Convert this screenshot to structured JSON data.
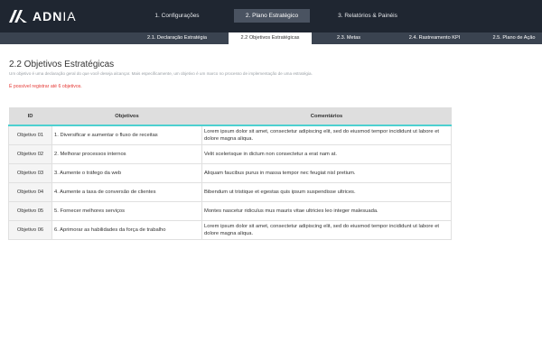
{
  "app": {
    "logo_text": "ADN",
    "logo_text_thin": "IA"
  },
  "main_tabs": [
    {
      "label": "1. Configurações",
      "active": false
    },
    {
      "label": "2. Plano Estratégico",
      "active": true
    },
    {
      "label": "3. Relatórios & Painéis",
      "active": false
    }
  ],
  "sub_tabs": [
    {
      "label": "2.1. Declaração Estratégia",
      "active": false
    },
    {
      "label": "2.2 Objetivos Estratégicas",
      "active": true
    },
    {
      "label": "2.3. Metas",
      "active": false
    },
    {
      "label": "2.4. Rastreamento KPI",
      "active": false
    },
    {
      "label": "2.5. Plano de Ação",
      "active": false
    }
  ],
  "page": {
    "title": "2.2 Objetivos Estratégicas",
    "description": "Um objetivo é uma declaração geral do que você deseja alcançar. Mais especificamente, um objetivo é um marco no processo de implementação de uma estratégia.",
    "limit_note": "É possível registrar até 6 objetivos."
  },
  "table": {
    "headers": {
      "id": "ID",
      "objective": "Objetivos",
      "comments": "Comentários"
    },
    "rows": [
      {
        "id": "Objetivo 01",
        "objective": "1. Diversificar e aumentar o fluxo de receitas",
        "comment": "Lorem ipsum dolor sit amet, consectetur adipiscing elit, sed do eiusmod tempor incididunt ut labore et dolore magna aliqua."
      },
      {
        "id": "Objetivo 02",
        "objective": "2. Melhorar processos internos",
        "comment": "Velit scelerisque in dictum non consectetur a erat nam at."
      },
      {
        "id": "Objetivo 03",
        "objective": "3. Aumente o tráfego da web",
        "comment": "Aliquam faucibus purus in massa tempor nec feugiat nisl pretium."
      },
      {
        "id": "Objetivo 04",
        "objective": "4. Aumente a taxa de conversão de clientes",
        "comment": "Bibendum ut tristique et egestas quis ipsum suspendisse ultrices."
      },
      {
        "id": "Objetivo 05",
        "objective": "5. Fornecer melhores serviços",
        "comment": "Montes nascetur ridiculus mus mauris vitae ultricies leo integer malesuada."
      },
      {
        "id": "Objetivo 06",
        "objective": "6. Aprimorar as habilidades da força de trabalho",
        "comment": "Lorem ipsum dolor sit amet, consectetur adipiscing elit, sed do eiusmod tempor incididunt ut labore et dolore magna aliqua."
      }
    ]
  },
  "colors": {
    "topbar": "#1f2631",
    "subbar": "#3a4350",
    "active_main_tab": "#4a5361",
    "header_accent": "#4dd0d0",
    "warning": "#e53935"
  }
}
